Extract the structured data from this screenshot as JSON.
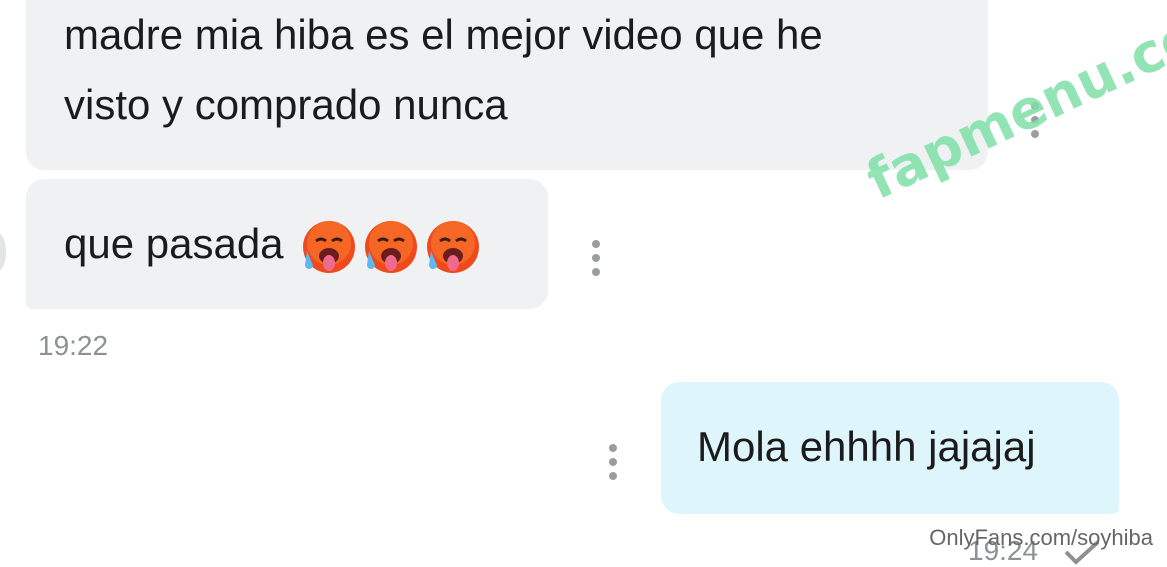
{
  "conversation": {
    "messages": [
      {
        "text": "madre mia hiba es el mejor video que he visto y comprado nunca",
        "line1": "madre mia hiba es el mejor video que he",
        "line2": "visto y comprado nunca",
        "direction": "incoming"
      },
      {
        "text": "que pasada",
        "emoji_count": 3,
        "emoji": "hot-face-emoji",
        "direction": "incoming"
      },
      {
        "text": "Mola ehhhh jajajaj",
        "direction": "outgoing"
      }
    ],
    "incoming_time": "19:22",
    "outgoing_time": "19:24"
  },
  "watermarks": {
    "brand": "fapmenu.com",
    "credit": "OnlyFans.com/soyhiba"
  },
  "colors": {
    "incoming_bubble": "#eff1f2",
    "outgoing_bubble": "#dff5fc",
    "brand_green": "#7fe0a8",
    "timestamp": "#8c9194"
  }
}
